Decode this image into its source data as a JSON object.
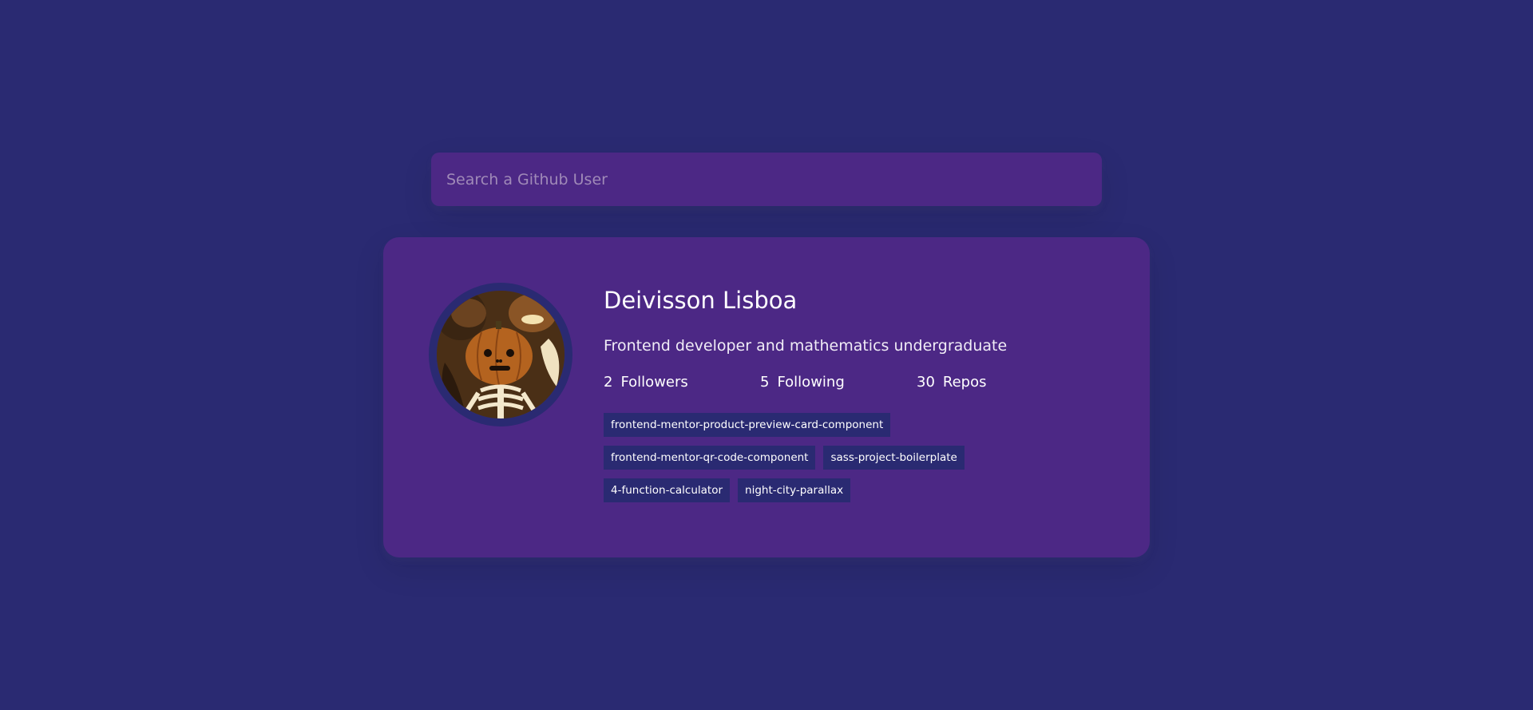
{
  "search": {
    "placeholder": "Search a Github User",
    "value": ""
  },
  "profile": {
    "avatar_icon": "avatar-image",
    "name": "Deivisson Lisboa",
    "bio": "Frontend developer and mathematics undergraduate",
    "stats": [
      {
        "count": "2",
        "label": "Followers"
      },
      {
        "count": "5",
        "label": "Following"
      },
      {
        "count": "30",
        "label": "Repos"
      }
    ],
    "repos": [
      "frontend-mentor-product-preview-card-component",
      "frontend-mentor-qr-code-component",
      "sass-project-boilerplate",
      "4-function-calculator",
      "night-city-parallax"
    ]
  },
  "colors": {
    "background": "#2a2a72",
    "card": "#4c2885",
    "tag": "#2a2a72",
    "text": "#ffffff"
  }
}
